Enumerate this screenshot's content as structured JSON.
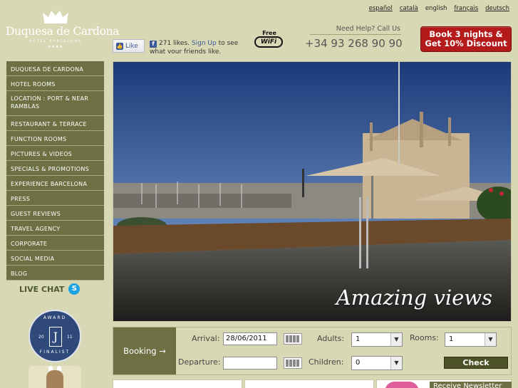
{
  "logo": {
    "brand": "Duquesa de Cardona",
    "subtitle": "HOTEL BARCELONA",
    "stars": "★★★★"
  },
  "languages": [
    {
      "label": "español",
      "current": false
    },
    {
      "label": "català",
      "current": false
    },
    {
      "label": "english",
      "current": true
    },
    {
      "label": "français",
      "current": false
    },
    {
      "label": "deutsch",
      "current": false
    }
  ],
  "facebook": {
    "like_label": "Like",
    "count_text": "271 likes.",
    "signup_link": "Sign Up",
    "rest_text": "to see what your friends like."
  },
  "wifi": {
    "free": "Free",
    "wifi": "WiFi"
  },
  "help": {
    "label": "Need Help? Call Us",
    "phone": "+34 93 268 90 90"
  },
  "promo": {
    "line1": "Book 3 nights &",
    "line2": "Get 10% Discount",
    "color": "#b41a1a"
  },
  "nav": [
    "DUQUESA DE CARDONA",
    "HOTEL ROOMS",
    "LOCATION : PORT & NEAR RAMBLAS",
    "RESTAURANT & TERRACE",
    "FUNCTION ROOMS",
    "PICTURES & VIDEOS",
    "SPECIALS & PROMOTIONS",
    "EXPERIENCE BARCELONA",
    "PRESS",
    "GUEST REVIEWS",
    "TRAVEL AGENCY",
    "CORPORATE",
    "SOCIAL MEDIA",
    "BLOG"
  ],
  "livechat": {
    "label": "LIVE CHAT",
    "icon": "skype-icon"
  },
  "award": {
    "top": "AWARD",
    "bottom": "FINALIST",
    "year_left": "20",
    "year_right": "11",
    "letter": "J"
  },
  "hero": {
    "caption": "Amazing views"
  },
  "booking": {
    "button": "Booking →",
    "arrival_label": "Arrival:",
    "arrival_value": "28/06/2011",
    "departure_label": "Departure:",
    "departure_value": "",
    "adults_label": "Adults:",
    "adults_value": "1",
    "children_label": "Children:",
    "children_value": "0",
    "rooms_label": "Rooms:",
    "rooms_value": "1",
    "check_label": "Check"
  },
  "newsletter": {
    "label": "Receive Newsletter"
  },
  "colors": {
    "background": "#d8d9b4",
    "nav": "#6c7043",
    "check": "#4c5127"
  }
}
